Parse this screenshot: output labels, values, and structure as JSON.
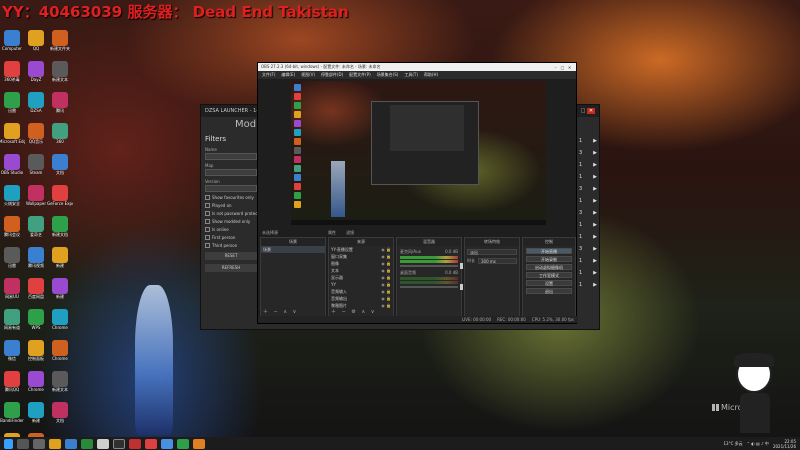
{
  "stream_banner": "YY：40463039   服务器：   Dead End Takistan",
  "desktop_icons": {
    "col1": [
      "Computer",
      "360杀毒",
      "迅雷",
      "Microsoft Edge",
      "OBS Studio",
      "火绒安全",
      "腾讯会议",
      "迅雷",
      "网易UU",
      "网易有道",
      "微信",
      "腾讯QQ",
      "BandiFinder",
      "NetEase"
    ],
    "col2": [
      "QQ",
      "DayZ",
      "DZSA",
      "QQ音乐",
      "Steam",
      "Wallpaper",
      "爱奇艺",
      "腾讯视频",
      "百度网盘",
      "WPS",
      "控制面板",
      "Chrome",
      "新建",
      "回收站"
    ],
    "col3": [
      "新建文件夹",
      "新建文本",
      "腾讯",
      "360",
      "文档",
      "GeForce Experience",
      "新建文档",
      "新建",
      "新建",
      "Chrome",
      "Chrome",
      "新建文本",
      "文档"
    ]
  },
  "dzsa": {
    "title": "DZSA LAUNCHER - 14,581",
    "mode_label": "Mod",
    "filters_heading": "Filters",
    "fields": [
      "Name",
      "Map",
      "Version"
    ],
    "checks": [
      "Show favourites only",
      "Played on",
      "Is not password protected",
      "Show modded only",
      "Is online",
      "First person",
      "Third person"
    ],
    "reset_label": "RESET",
    "refresh_label": "REFRESH",
    "arrows": [
      "1",
      "3",
      "1",
      "1",
      "3",
      "1",
      "3",
      "1",
      "1",
      "3",
      "1",
      "1",
      "1"
    ]
  },
  "obs": {
    "title": "OBS 27.2.3 (64-bit, windows) - 配置文件: 未命名 - 场景: 未命名",
    "menu": [
      "文件(F)",
      "编辑(E)",
      "视图(V)",
      "停靠部件(D)",
      "配置文件(P)",
      "场景集合(S)",
      "工具(T)",
      "帮助(H)"
    ],
    "source_bar": [
      "未选择源",
      "属性",
      "滤镜"
    ],
    "docks": {
      "scenes": {
        "title": "场景",
        "items": [
          "场景"
        ]
      },
      "sources": {
        "title": "来源",
        "items": [
          "YY-直播设置",
          "窗口采集",
          "图像",
          "文本",
          "显示器",
          "YY",
          "音频输入",
          "音频输出",
          "黎雅图片"
        ]
      },
      "mixer": {
        "title": "混音器",
        "channels": [
          {
            "name": "麦克风/Aux",
            "db": "0.0 dB"
          },
          {
            "name": "桌面音频",
            "db": "0.0 dB"
          }
        ]
      },
      "transitions": {
        "title": "转场特效",
        "rows": [
          {
            "label": "",
            "value": "淡出"
          },
          {
            "label": "时长",
            "value": "300 ms"
          }
        ]
      },
      "controls": {
        "title": "控制",
        "buttons": [
          "开始直播",
          "开始录制",
          "启动虚拟摄像机",
          "工作室模式",
          "设置",
          "退出"
        ]
      }
    },
    "status": [
      "LIVE: 00:00:00",
      "REC: 00:00:00",
      "CPU: 5.2%, 30.00 fps"
    ]
  },
  "taskbar": {
    "temp": "13°C 多云",
    "time": "22:05",
    "date": "2021/11/26"
  },
  "watermark": "Microsoft"
}
